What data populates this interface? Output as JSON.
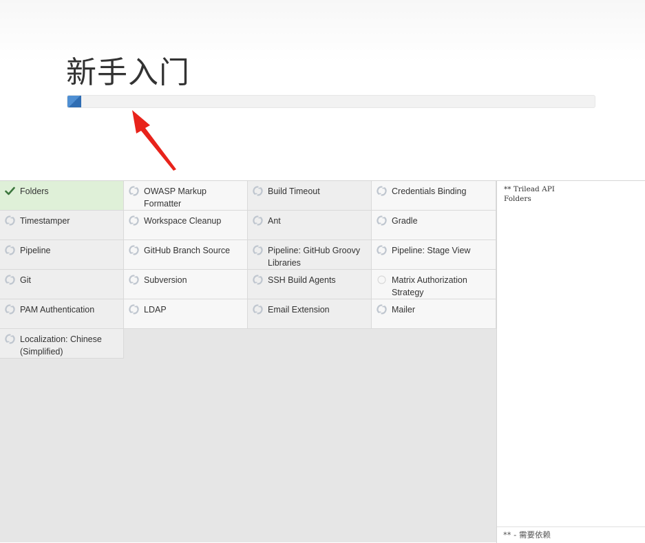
{
  "header": {
    "title": "新手入门",
    "progress_fraction": 0.026
  },
  "plugins": [
    {
      "name": "Folders",
      "status": "done"
    },
    {
      "name": "OWASP Markup Formatter",
      "status": "pending"
    },
    {
      "name": "Build Timeout",
      "status": "pending"
    },
    {
      "name": "Credentials Binding",
      "status": "pending"
    },
    {
      "name": "Timestamper",
      "status": "pending"
    },
    {
      "name": "Workspace Cleanup",
      "status": "pending"
    },
    {
      "name": "Ant",
      "status": "pending"
    },
    {
      "name": "Gradle",
      "status": "pending"
    },
    {
      "name": "Pipeline",
      "status": "pending"
    },
    {
      "name": "GitHub Branch Source",
      "status": "pending"
    },
    {
      "name": "Pipeline: GitHub Groovy Libraries",
      "status": "pending"
    },
    {
      "name": "Pipeline: Stage View",
      "status": "pending"
    },
    {
      "name": "Git",
      "status": "pending"
    },
    {
      "name": "Subversion",
      "status": "pending"
    },
    {
      "name": "SSH Build Agents",
      "status": "pending"
    },
    {
      "name": "Matrix Authorization Strategy",
      "status": "not-started"
    },
    {
      "name": "PAM Authentication",
      "status": "pending"
    },
    {
      "name": "LDAP",
      "status": "pending"
    },
    {
      "name": "Email Extension",
      "status": "pending"
    },
    {
      "name": "Mailer",
      "status": "pending"
    },
    {
      "name": "Localization: Chinese (Simplified)",
      "status": "pending"
    }
  ],
  "install_log": {
    "lines": [
      "** Trilead API",
      "Folders"
    ],
    "footer": "** - 需要依赖"
  },
  "colors": {
    "done_background": "#dff0d8",
    "check": "#3c763d",
    "spinner": "#bfc6cf",
    "progress": "#4f8fd3",
    "arrow": "#e8231b"
  }
}
